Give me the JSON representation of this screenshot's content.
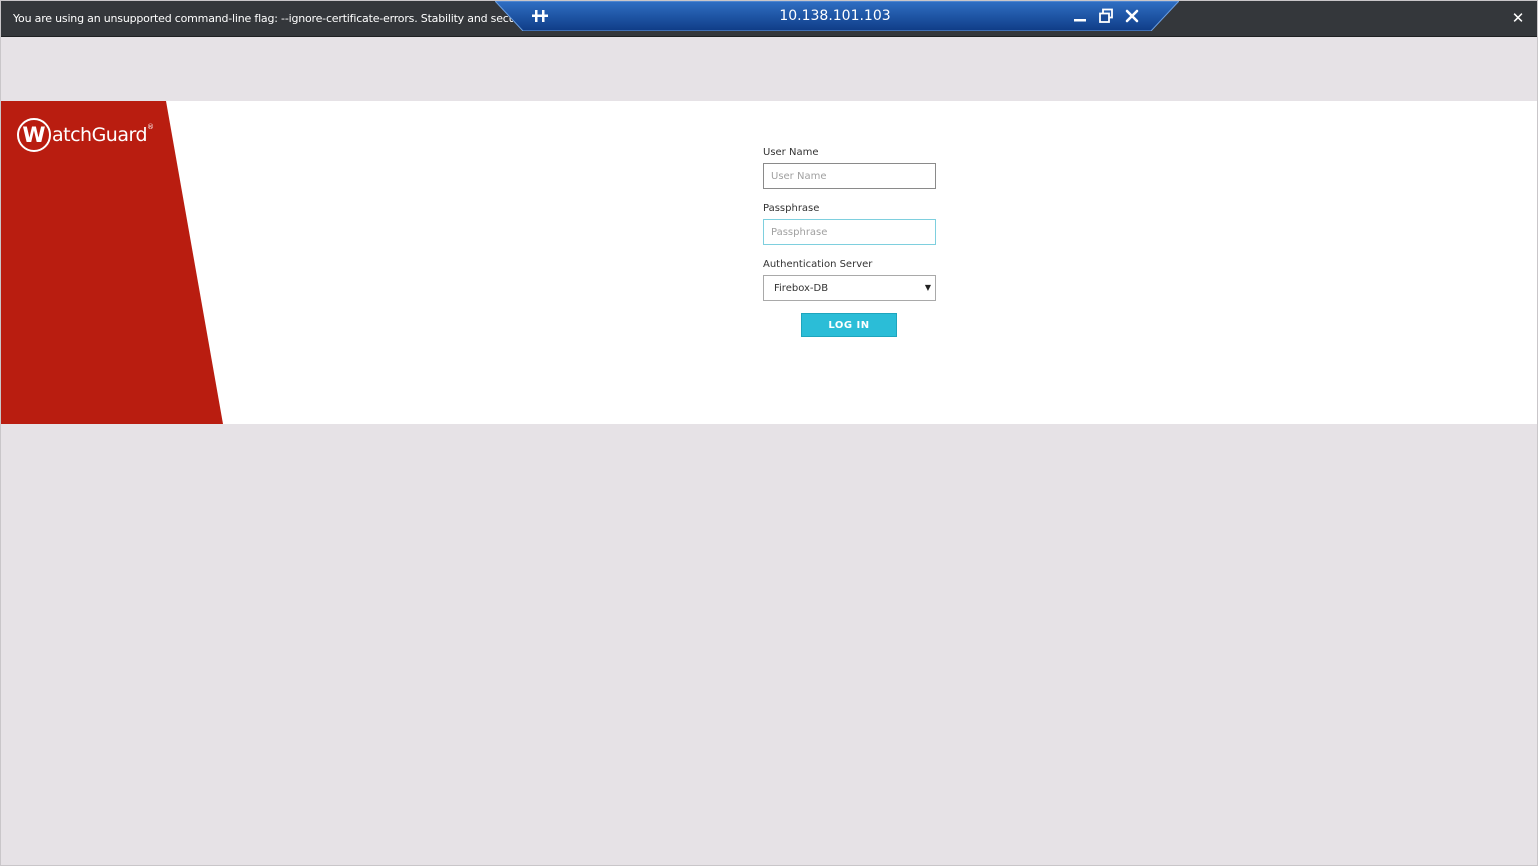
{
  "warning_bar": {
    "message": "You are using an unsupported command-line flag: --ignore-certificate-errors. Stability and security will suffer.",
    "close_glyph": "✕"
  },
  "connection_bar": {
    "title": "10.138.101.103",
    "color_top": "#2f6fc4",
    "color_bottom": "#0f3c86"
  },
  "brand": {
    "logo_initial": "W",
    "logo_rest": "atchGuard",
    "registered": "®",
    "color": "#b91d10"
  },
  "login": {
    "username_label": "User Name",
    "username_placeholder": "User Name",
    "passphrase_label": "Passphrase",
    "passphrase_placeholder": "Passphrase",
    "auth_server_label": "Authentication Server",
    "auth_server_value": "Firebox-DB",
    "login_button": "LOG IN",
    "button_color": "#2bbdd7"
  }
}
